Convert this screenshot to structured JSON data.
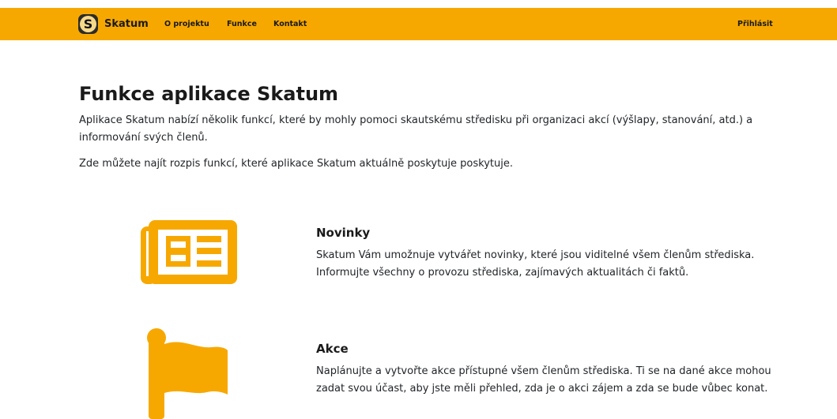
{
  "header": {
    "logo_letter": "S",
    "brand": "Skatum",
    "nav": [
      {
        "label": "O projektu"
      },
      {
        "label": "Funkce"
      },
      {
        "label": "Kontakt"
      }
    ],
    "login_label": "Přihlásit",
    "accent_color": "#f7a800"
  },
  "main": {
    "title": "Funkce aplikace Skatum",
    "intro_1": "Aplikace Skatum nabízí několik funkcí, které by mohly pomoci skautskému středisku při organizaci akcí (výšlapy, stanování, atd.) a informování svých členů.",
    "intro_2": "Zde můžete najít rozpis funkcí, které aplikace Skatum aktuálně poskytuje poskytuje.",
    "features": [
      {
        "icon": "newspaper-icon",
        "title": "Novinky",
        "text": "Skatum Vám umožnuje vytvářet novinky, které jsou viditelné všem členům střediska. Informujte všechny o provozu střediska, zajímavých aktualitách či faktů."
      },
      {
        "icon": "flag-icon",
        "title": "Akce",
        "text": "Naplánujte a vytvořte akce přístupné všem členům střediska. Ti se na dané akce mohou zadat svou účast, aby jste měli přehled, zda je o akci zájem a zda se bude vůbec konat."
      }
    ]
  }
}
